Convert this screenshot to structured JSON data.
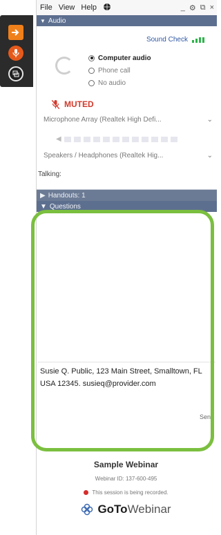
{
  "menubar": {
    "file": "File",
    "view": "View",
    "help": "Help"
  },
  "audio": {
    "section_title": "Audio",
    "sound_check": "Sound Check",
    "options": [
      {
        "label": "Computer audio",
        "selected": true
      },
      {
        "label": "Phone call",
        "selected": false
      },
      {
        "label": "No audio",
        "selected": false
      }
    ],
    "muted_label": "MUTED",
    "microphone": "Microphone Array (Realtek High Defi...",
    "speakers": "Speakers / Headphones (Realtek Hig...",
    "talking_label": "Talking:"
  },
  "handouts": {
    "title": "Handouts: 1"
  },
  "questions": {
    "title": "Questions",
    "input_text": "Susie Q. Public, 123 Main Street, Smalltown, FL USA 12345. susieq@provider.com",
    "send_label": "Send"
  },
  "webinar": {
    "name": "Sample Webinar",
    "id_line": "Webinar ID: 137-600-495",
    "recording": "This session is being recorded.",
    "brand_bold": "GoTo",
    "brand_light": "Webinar"
  },
  "colors": {
    "highlight_frame": "#7bbf3f",
    "header": "#5d6f8f",
    "muted": "#d13a2c"
  }
}
